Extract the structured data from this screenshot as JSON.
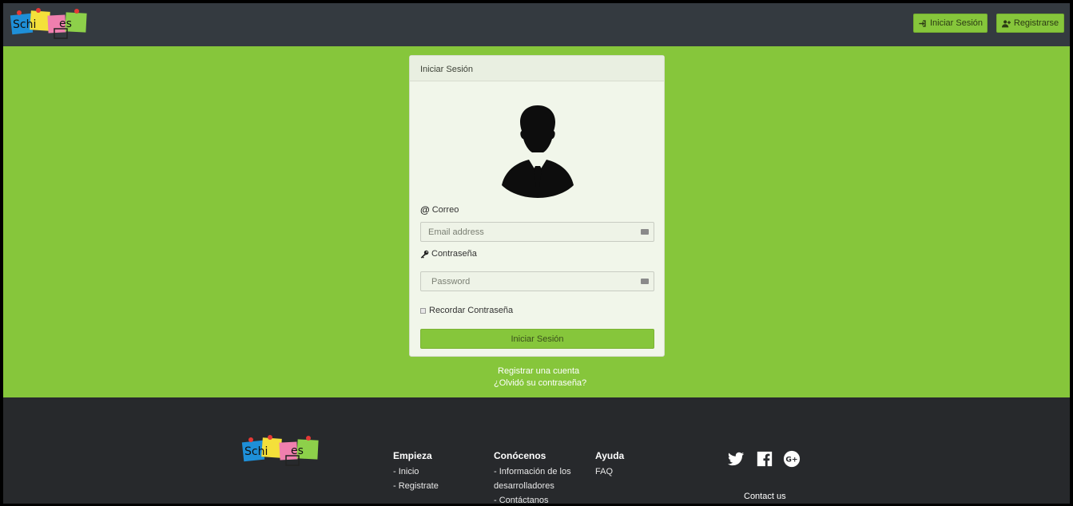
{
  "header": {
    "logo_text": "Schinotes",
    "login_label": "Iniciar Sesión",
    "register_label": "Registrarse"
  },
  "card": {
    "title": "Iniciar Sesión",
    "email_label": "Correo",
    "email_placeholder": "Email address",
    "password_label": "Contraseña",
    "password_placeholder": "Password",
    "remember_label": "Recordar Contraseña",
    "submit_label": "Iniciar Sesión"
  },
  "links": {
    "register_account": "Registrar una cuenta",
    "forgot_password": "¿Olvidó su contraseña?"
  },
  "footer": {
    "logo_text": "Schinotes",
    "columns": [
      {
        "title": "Empieza",
        "items": [
          "- Inicio",
          "- Registrate"
        ]
      },
      {
        "title": "Conócenos",
        "items": [
          "- Información de los",
          "desarrolladores",
          "- Contáctanos"
        ]
      },
      {
        "title": "Ayuda",
        "items": [
          "FAQ"
        ]
      }
    ],
    "social": [
      "twitter-icon",
      "facebook-icon",
      "google-plus-icon"
    ],
    "contact_label": "Contact us"
  },
  "colors": {
    "brand_green": "#86c63b",
    "header_dark": "#343a40",
    "footer_dark": "#27292c"
  }
}
